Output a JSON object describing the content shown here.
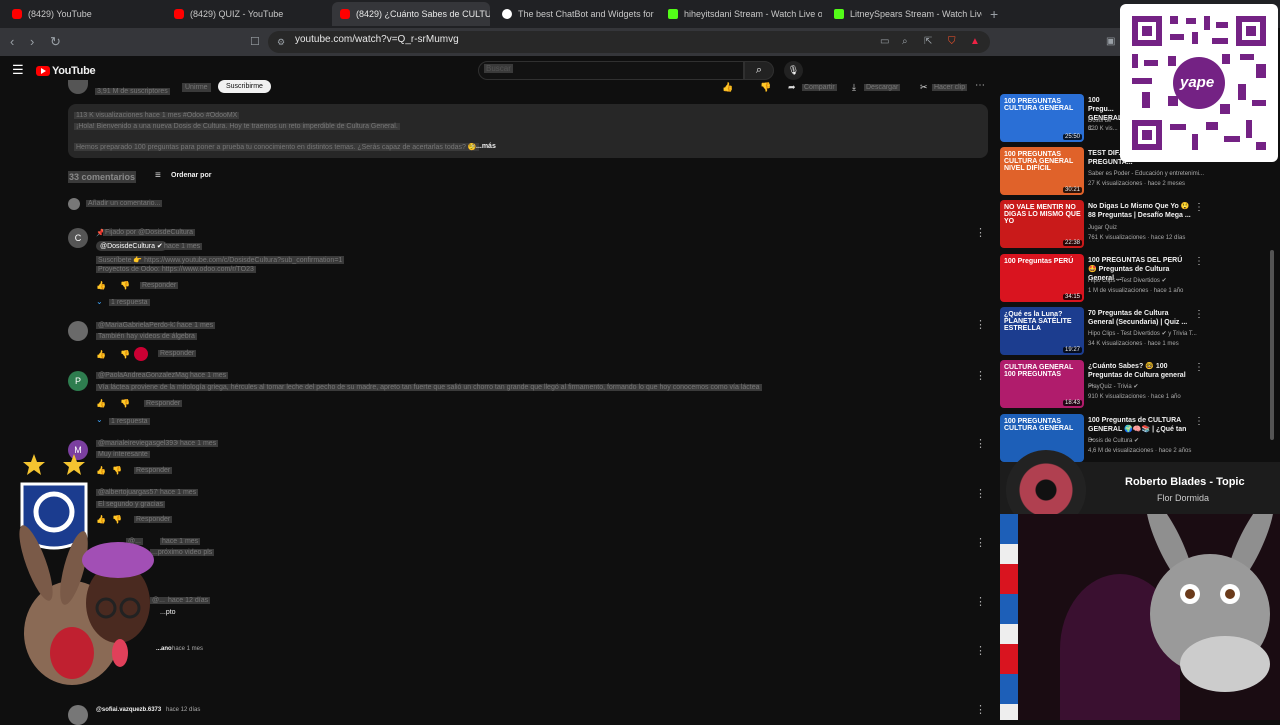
{
  "browser": {
    "tabs": [
      {
        "title": "(8429) YouTube",
        "icon": "youtube-icon",
        "active": false
      },
      {
        "title": "(8429) QUIZ - YouTube",
        "icon": "youtube-icon",
        "active": false
      },
      {
        "title": "(8429) ¿Cuánto Sabes de CULTU",
        "icon": "youtube-icon",
        "active": true
      },
      {
        "title": "The best ChatBot and Widgets for Ki",
        "icon": "chatbot-icon",
        "active": false
      },
      {
        "title": "hiheyitsdani Stream - Watch Live on",
        "icon": "kick-icon",
        "active": false
      },
      {
        "title": "LitneySpears Stream - Watch Live",
        "icon": "kick-icon",
        "active": false
      }
    ],
    "close_glyph": "×",
    "new_tab_glyph": "+",
    "url": "youtube.com/watch?v=Q_r-srMumvg"
  },
  "youtube": {
    "logo_text": "YouTube",
    "search_placeholder": "Buscar",
    "channel": {
      "subs": "3,91 M de suscriptores",
      "joined": "Unirme",
      "subscribe": "Suscribirme"
    },
    "actions": [
      "Compartir",
      "Descargar",
      "Hacer clip"
    ],
    "description": {
      "stats": "113 K visualizaciones hace 1 mes #Odoo #OdooMX",
      "line1": "¡Hola! Bienvenido a una nueva Dosis de Cultura. Hoy te traemos un reto imperdible de Cultura General.",
      "line2": "Hemos preparado 100 preguntas para poner a prueba tu conocimiento en distintos temas. ¿Serás capaz de acertarlas todas? 🧐",
      "more": "...más"
    },
    "comments_header": {
      "count": "33 comentarios",
      "sort": "Ordenar por"
    },
    "add_comment": "Añadir un comentario...",
    "comments": [
      {
        "pinned": "Fijado por @DosisdeCultura",
        "author": "@DosisdeCultura ✔",
        "time": "hace 1 mes",
        "lines": [
          "Suscríbete 👉 https://www.youtube.com/c/DosisdeCultura?sub_confirmation=1",
          "Proyectos de Odoo: https://www.odoo.com/r/TO23"
        ],
        "reply": "Responder",
        "replies": "1 respuesta",
        "avatar_letter": "C",
        "avatar_color": "#555555"
      },
      {
        "author": "@MariaGabrielaPerdo-k3b",
        "time": "hace 1 mes",
        "lines": [
          "También hay videos de álgebra"
        ],
        "reply": "Responder",
        "avatar_letter": "",
        "avatar_color": "#6a6a6a"
      },
      {
        "author": "@PaolaAndreaGonzalezMagan",
        "time": "hace 1 mes",
        "lines": [
          "Vía láctea proviene de la mitología griega, hércules al tomar leche del pecho de su madre, apreto tan fuerte que salió un chorro tan grande que llegó al firmamento, formando lo que hoy conocemos como vía láctea"
        ],
        "reply": "Responder",
        "replies": "1 respuesta",
        "avatar_letter": "P",
        "avatar_color": "#2e7d4f"
      },
      {
        "author": "@marialeireviegasgel3936",
        "time": "hace 1 mes",
        "lines": [
          "Muy interesante"
        ],
        "reply": "Responder",
        "avatar_letter": "M",
        "avatar_color": "#7b3fa0"
      },
      {
        "author": "@albertojuargas5798",
        "time": "hace 1 mes",
        "lines": [
          "El segundo y gracias"
        ],
        "reply": "Responder",
        "avatar_letter": "",
        "avatar_color": "#444444"
      },
      {
        "author": "@...",
        "time": "hace 1 mes",
        "lines": [
          "...próximo video pls"
        ],
        "reply": "",
        "avatar_letter": "",
        "avatar_color": "#444444"
      },
      {
        "author": "@...",
        "time": "hace 12 días",
        "lines": [
          "...pto"
        ],
        "reply": "",
        "avatar_letter": "",
        "avatar_color": "#444444"
      },
      {
        "author": "...ano",
        "time": "hace 1 mes",
        "lines": [],
        "reply": "",
        "avatar_letter": "",
        "avatar_color": "#444444"
      },
      {
        "author": "@sofiai.vazquezb.6373",
        "time": "hace 12 días",
        "lines": [],
        "reply": "",
        "avatar_letter": "",
        "avatar_color": "#777777"
      }
    ],
    "sidebar": [
      {
        "title": "100 Pregu... GENERAL",
        "channel": "Dosis de C...",
        "meta": "320 K vis...",
        "duration": "25:50",
        "thumb_text": "100 PREGUNTAS CULTURA GENERAL",
        "color": "#2a6fd6"
      },
      {
        "title": "TEST DIF... GENERAL 🔥 | 100 PREGUNTA...",
        "channel": "Saber es Poder - Educación y entretenimi...",
        "meta": "27 K visualizaciones · hace 2 meses",
        "duration": "30:21",
        "thumb_text": "100 PREGUNTAS CULTURA GENERAL NIVEL DIFÍCIL",
        "color": "#e0622a"
      },
      {
        "title": "No Digas Lo Mismo Que Yo 😲 88 Preguntas | Desafío Mega ...",
        "channel": "Jugar Quiz",
        "meta": "761 K visualizaciones · hace 12 días",
        "duration": "22:38",
        "thumb_text": "NO VALE MENTIR NO DIGAS LO MISMO QUE YO",
        "color": "#c91a1a"
      },
      {
        "title": "100 PREGUNTAS DEL PERÚ 🤩 Preguntas de Cultura General ...",
        "channel": "Hipo Clips - Test Divertidos ✔",
        "meta": "1 M de visualizaciones · hace 1 año",
        "duration": "34:15",
        "thumb_text": "100 Preguntas PERÚ",
        "color": "#d9141f"
      },
      {
        "title": "70 Preguntas de Cultura General (Secundaria) | Quiz ...",
        "channel": "Hipo Clips - Test Divertidos ✔ y Trivia T...",
        "meta": "34 K visualizaciones · hace 1 mes",
        "duration": "19:27",
        "thumb_text": "¿Qué es la Luna? PLANETA SATÉLITE ESTRELLA",
        "color": "#1c3d8f"
      },
      {
        "title": "¿Cuánto Sabes? 🤓 100 Preguntas de Cultura general ...",
        "channel": "PlayQuiz - Trivia ✔",
        "meta": "910 K visualizaciones · hace 1 año",
        "duration": "18:43",
        "thumb_text": "CULTURA GENERAL 100 PREGUNTAS",
        "color": "#b01c6c"
      },
      {
        "title": "100 Preguntas de CULTURA GENERAL 🌍🧠📚 | ¿Qué tan ...",
        "channel": "Dosis de Cultura ✔",
        "meta": "4,6 M de visualizaciones · hace 2 años",
        "duration": "",
        "thumb_text": "100 PREGUNTAS CULTURA GENERAL",
        "color": "#1d5fb8"
      }
    ]
  },
  "overlays": {
    "qr_label": "yape",
    "music_title": "Roberto Blades - Topic",
    "music_track": "Flor Dormida"
  },
  "colors": {
    "youtube_red": "#ff0000",
    "kick_green": "#53fc18",
    "yape_purple": "#742284"
  }
}
